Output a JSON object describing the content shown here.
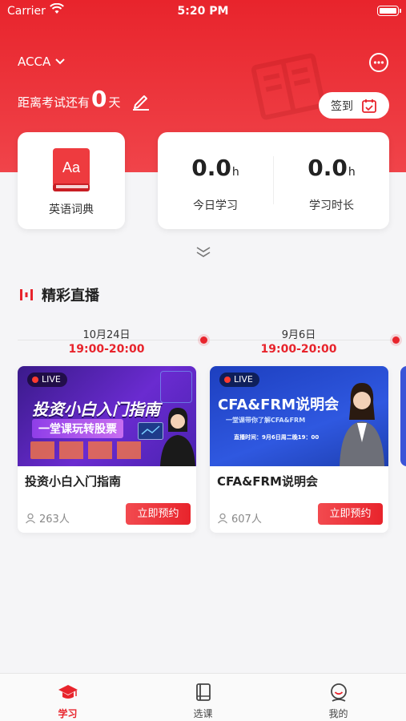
{
  "status_bar": {
    "carrier": "Carrier",
    "time": "5:20 PM"
  },
  "header": {
    "course": "ACCA",
    "countdown_prefix": "距离考试还有",
    "countdown_days": "0",
    "countdown_suffix": "天",
    "signin_label": "签到"
  },
  "dictionary": {
    "label": "英语词典",
    "icon_text": "Aa"
  },
  "stats": [
    {
      "value": "0.0",
      "unit": "h",
      "label": "今日学习"
    },
    {
      "value": "0.0",
      "unit": "h",
      "label": "学习时长"
    }
  ],
  "section": {
    "title": "精彩直播"
  },
  "lives": [
    {
      "date": "10月24日",
      "time": "19:00-20:00",
      "badge": "LIVE",
      "banner_title": "投资小白入门指南",
      "banner_subtitle": "一堂课玩转股票",
      "title": "投资小白入门指南",
      "count": "263人",
      "button": "立即预约"
    },
    {
      "date": "9月6日",
      "time": "19:00-20:00",
      "badge": "LIVE",
      "banner_title": "CFA&FRM说明会",
      "banner_subtitle": "一堂课带你了解CFA&FRM",
      "banner_time": "直播时间：9月6日周二晚19：00",
      "title": "CFA&FRM说明会",
      "count": "607人",
      "button": "立即预约"
    }
  ],
  "tabs": [
    {
      "label": "学习",
      "icon": "graduation-cap-icon",
      "active": true
    },
    {
      "label": "选课",
      "icon": "book-icon",
      "active": false
    },
    {
      "label": "我的",
      "icon": "profile-icon",
      "active": false
    }
  ],
  "colors": {
    "brand": "#e8242c",
    "background": "#f5f5f7"
  }
}
